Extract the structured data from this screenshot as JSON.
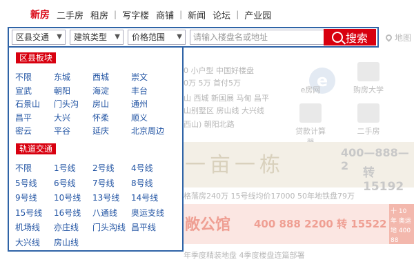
{
  "nav": {
    "items": [
      "新房",
      "二手房",
      "租房",
      "写字楼",
      "商铺",
      "新闻",
      "论坛",
      "产业园"
    ]
  },
  "search": {
    "district_select": "区县交通",
    "building_select": "建筑类型",
    "price_select": "价格范围",
    "placeholder": "请输入楼盘名或地址",
    "button_label": "搜索",
    "map_link": "地图"
  },
  "dropdown": {
    "district_heading": "区县板块",
    "districts": [
      "不限",
      "东城",
      "西城",
      "崇文",
      "宣武",
      "朝阳",
      "海淀",
      "丰台",
      "石景山",
      "门头沟",
      "房山",
      "通州",
      "昌平",
      "大兴",
      "怀柔",
      "顺义",
      "密云",
      "平谷",
      "延庆",
      "北京周边"
    ],
    "transit_heading": "轨道交通",
    "lines": [
      "不限",
      "1号线",
      "2号线",
      "4号线",
      "5号线",
      "6号线",
      "7号线",
      "8号线",
      "9号线",
      "10号线",
      "13号线",
      "14号线",
      "15号线",
      "16号线",
      "八通线",
      "奥运支线",
      "机场线",
      "亦庄线",
      "门头沟线",
      "昌平线",
      "大兴线",
      "房山线"
    ]
  },
  "background": {
    "row1": "0 小户型  中国好楼盘",
    "row2": "0万  5万  首付5万",
    "row3": "山  西城  新国展  马甸  昌平",
    "row4": "山别墅区  房山线  大兴线",
    "row5": "西山)  朝阳北路",
    "icon1": "e",
    "icon_label1": "e房网",
    "icon_label2": "购房大学",
    "icon_label3": "贷款计算器",
    "icon_label4": "二手房",
    "banner1_text": "一亩一栋",
    "banner1_phone": "400—888—2",
    "banner1_phone2": "转15192",
    "row6": "格落房240万    15号线均价17000    50年地铁盘79万",
    "banner2_title": "敞公馆",
    "banner2_tel": "400 888 2200 转 15522",
    "banner2_side": "十 10年 奥运 地 400 88",
    "row7": "年季度精装地盘  4季度楼盘连篇部署"
  },
  "colors": {
    "accent": "#d8000f",
    "border": "#2e63a6",
    "link": "#2254a3"
  }
}
